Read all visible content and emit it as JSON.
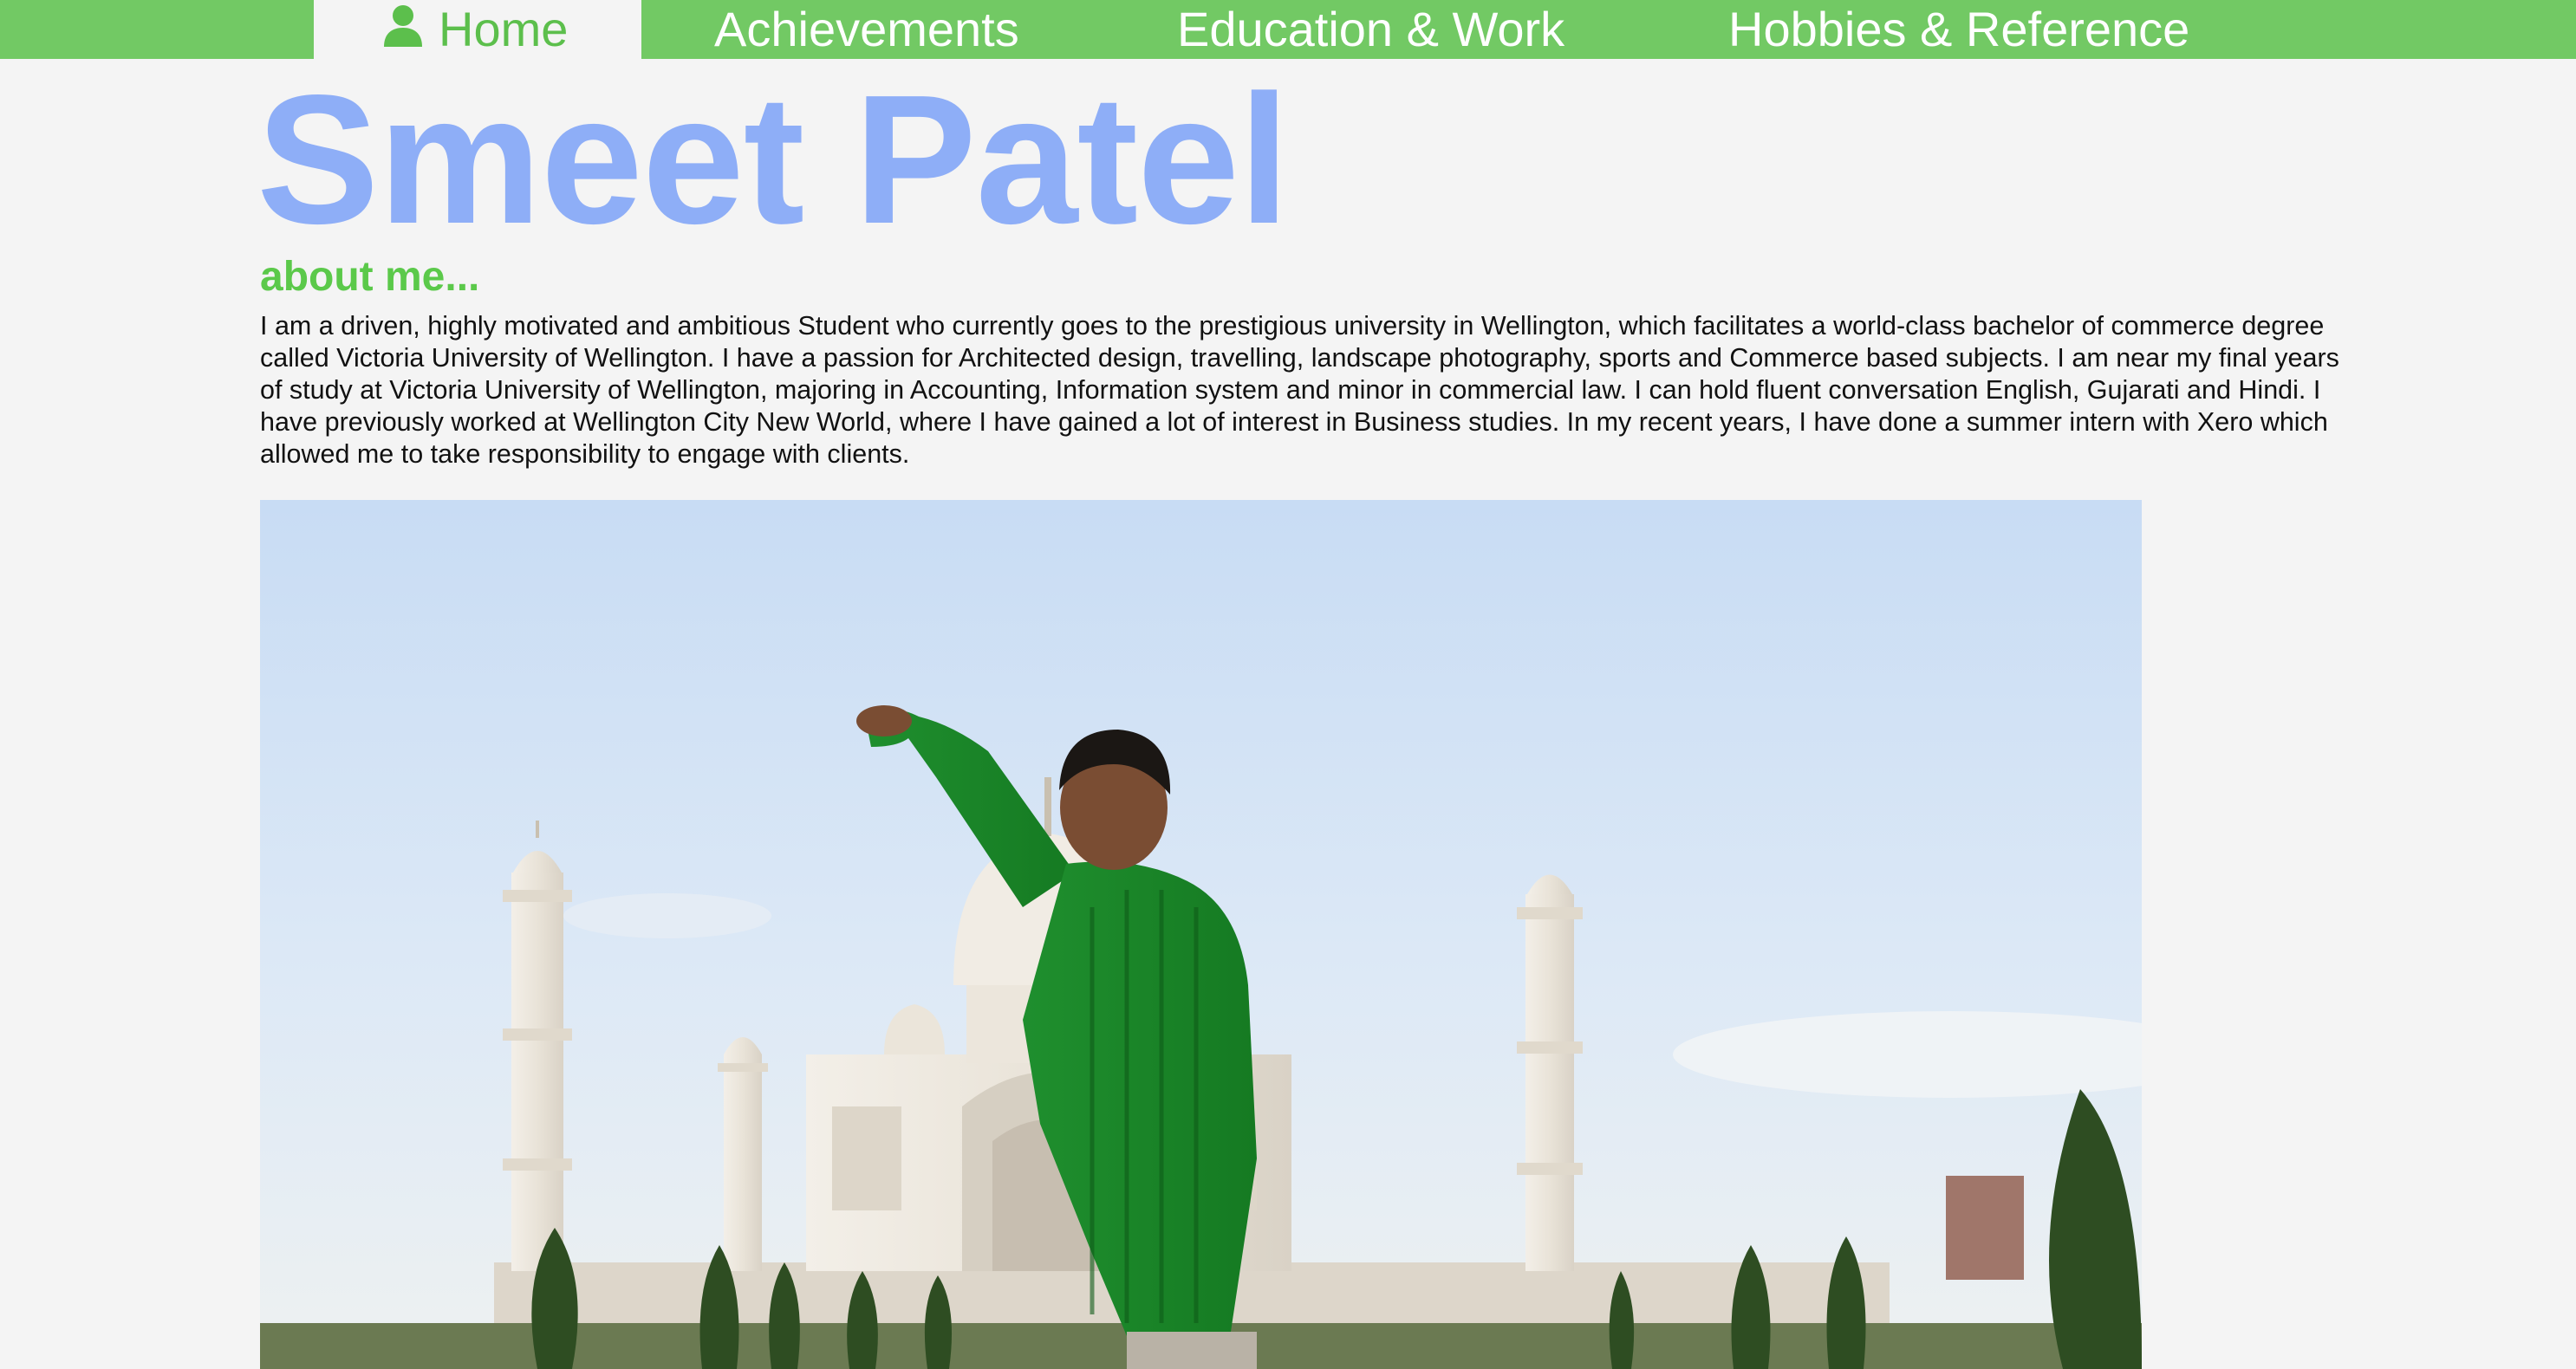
{
  "nav": {
    "home": {
      "icon": "user-icon",
      "label": "Home"
    },
    "achievements": "Achievements",
    "education_work": "Education & Work",
    "hobbies_reference": "Hobbies & Reference"
  },
  "header": {
    "name": "Smeet Patel"
  },
  "about": {
    "heading": "about me...",
    "body": "I am a driven, highly motivated and ambitious Student who currently goes to the prestigious university in Wellington, which facilitates a world-class bachelor of commerce degree called Victoria University of Wellington. I have a passion for Architected design, travelling, landscape photography, sports and Commerce based subjects. I am near my final years of study at Victoria University of Wellington, majoring in Accounting, Information system and minor in commercial law. I can hold fluent conversation English, Gujarati and Hindi. I have previously worked at Wellington City New World, where I have gained a lot of interest in Business studies. In my recent years, I have done a summer intern with Xero which allowed me to take responsibility to engage with clients."
  },
  "colors": {
    "nav_bar": "#72c964",
    "nav_active_text": "#5cbf4c",
    "name": "#8eaef7",
    "about_heading": "#5bc94a",
    "page_bg": "#f4f4f4"
  }
}
